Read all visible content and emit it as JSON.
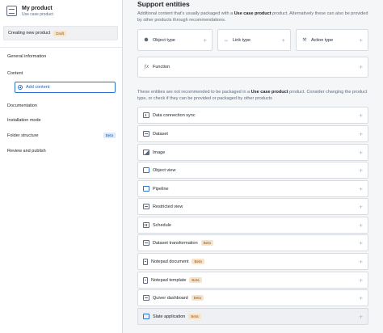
{
  "sidebar": {
    "product_name": "My product",
    "product_subtitle": "Use case product",
    "state_text": "Creating new product",
    "state_tag": "Draft",
    "nav": [
      {
        "label": "General information"
      },
      {
        "label": "Content"
      },
      {
        "label": "Documentation"
      },
      {
        "label": "Installation mode"
      },
      {
        "label": "Folder structure",
        "badge": "Beta"
      },
      {
        "label": "Review and publish"
      }
    ],
    "add_content_label": "Add content"
  },
  "main": {
    "title": "Support entities",
    "intro_text": "Additional content that's usually packaged with a ",
    "intro_bold": "Use case product",
    "intro_rest": " product. Alternatively these can also be provided by other products through recommendations.",
    "cards": [
      {
        "label": "Object type",
        "icon": "cube-icon"
      },
      {
        "label": "Link type",
        "icon": "link-icon"
      },
      {
        "label": "Action type",
        "icon": "action-icon"
      },
      {
        "label": "Function",
        "icon": "function-icon"
      }
    ],
    "warn_text": "These entities are not recommended to be packaged in a ",
    "warn_bold": "Use case product",
    "warn_rest": " product. Consider changing the product type, or check if they can be provided or packaged by other products",
    "rows": [
      {
        "label": "Data connection sync"
      },
      {
        "label": "Dataset"
      },
      {
        "label": "Image"
      },
      {
        "label": "Object view"
      },
      {
        "label": "Pipeline"
      },
      {
        "label": "Restricted view"
      },
      {
        "label": "Schedule"
      },
      {
        "label": "Dataset transformation",
        "badge": "Beta"
      },
      {
        "label": "Notepad document",
        "badge": "Beta"
      },
      {
        "label": "Notepad template",
        "badge": "Beta"
      },
      {
        "label": "Quiver dashboard",
        "badge": "Beta"
      },
      {
        "label": "Slate application",
        "badge": "Beta"
      }
    ],
    "plus_symbol": "+"
  }
}
